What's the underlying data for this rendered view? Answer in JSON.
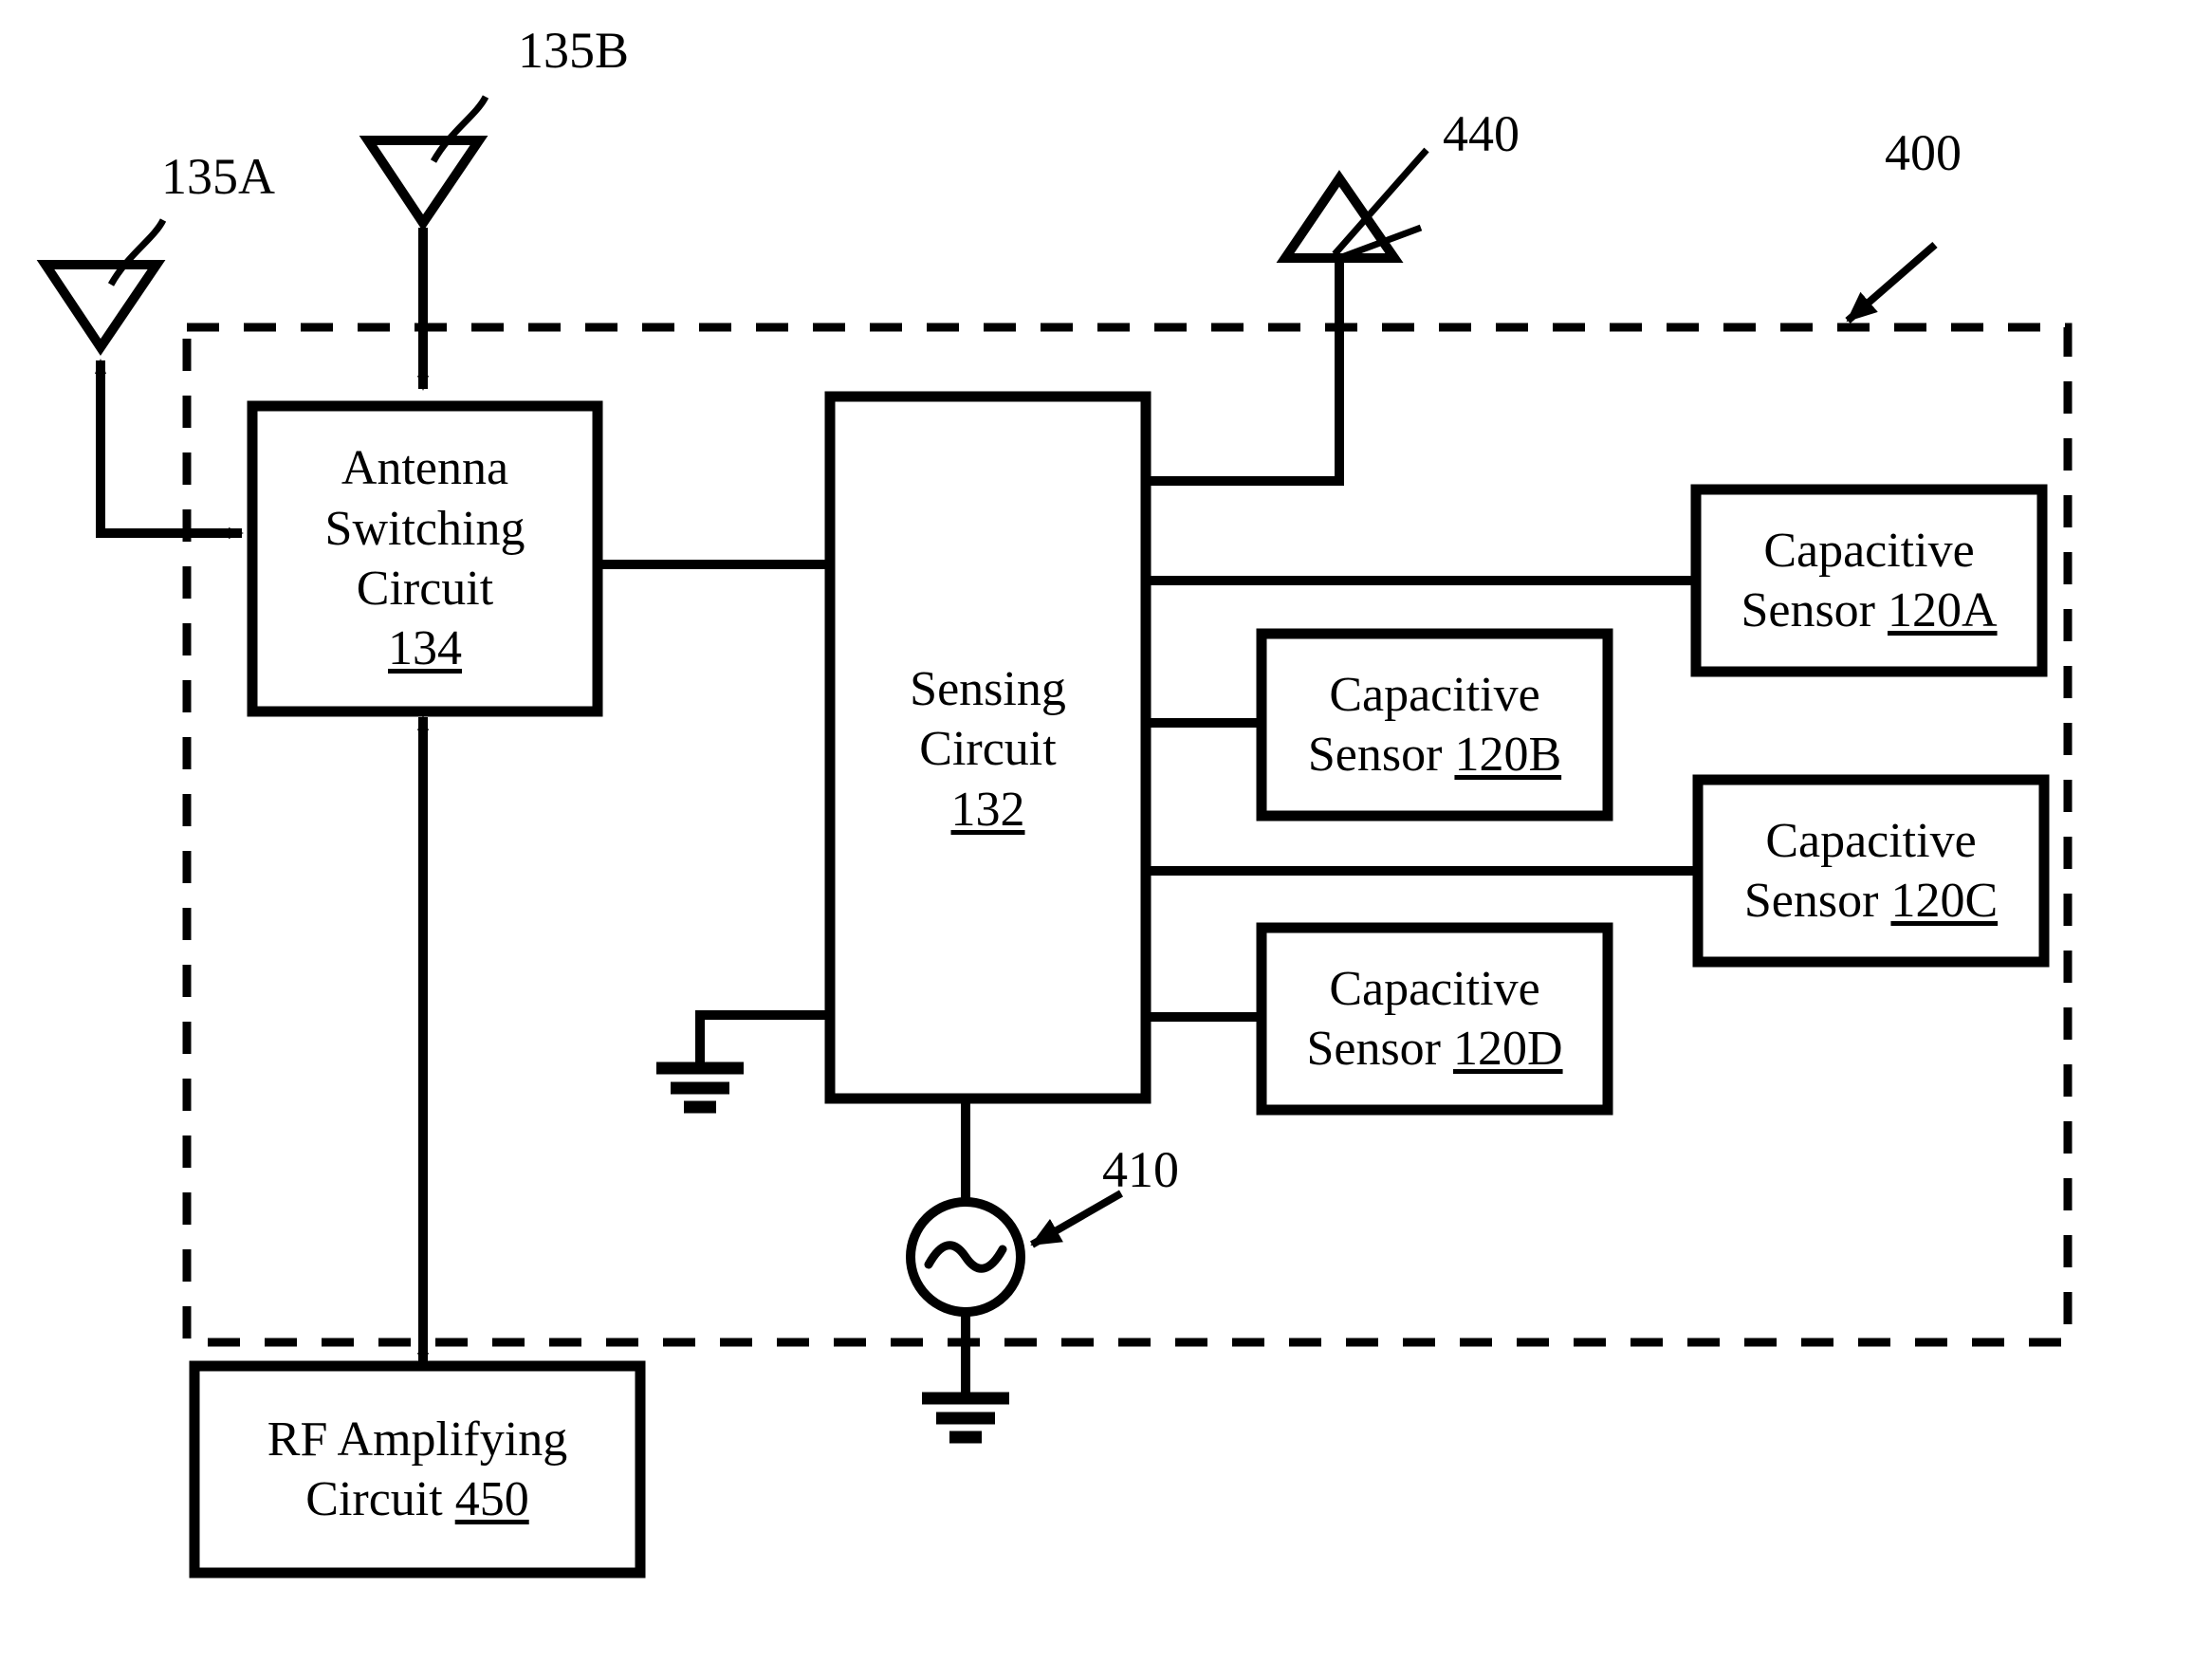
{
  "figure": {
    "type": "patent-block-diagram",
    "reference_labels": [
      {
        "id": "ref-135a",
        "text": "135A"
      },
      {
        "id": "ref-135b",
        "text": "135B"
      },
      {
        "id": "ref-440",
        "text": "440"
      },
      {
        "id": "ref-400",
        "text": "400"
      },
      {
        "id": "ref-410",
        "text": "410"
      }
    ],
    "blocks": [
      {
        "id": "antenna-switching-circuit",
        "lines": [
          "Antenna",
          "Switching",
          "Circuit"
        ],
        "number": "134",
        "number_inline": false
      },
      {
        "id": "sensing-circuit",
        "lines": [
          "Sensing",
          "Circuit"
        ],
        "number": "132",
        "number_inline": false
      },
      {
        "id": "capacitive-sensor-120a",
        "lines": [
          "Capacitive",
          "Sensor"
        ],
        "number": "120A",
        "number_inline": true
      },
      {
        "id": "capacitive-sensor-120b",
        "lines": [
          "Capacitive",
          "Sensor"
        ],
        "number": "120B",
        "number_inline": true
      },
      {
        "id": "capacitive-sensor-120c",
        "lines": [
          "Capacitive",
          "Sensor"
        ],
        "number": "120C",
        "number_inline": true
      },
      {
        "id": "capacitive-sensor-120d",
        "lines": [
          "Capacitive",
          "Sensor"
        ],
        "number": "120D",
        "number_inline": true
      },
      {
        "id": "rf-amplifying-circuit",
        "lines": [
          "RF Amplifying",
          "Circuit"
        ],
        "number": "450",
        "number_inline": true
      }
    ],
    "symbols": [
      {
        "id": "antenna-135a",
        "kind": "antenna-triangle-down"
      },
      {
        "id": "antenna-135b",
        "kind": "antenna-triangle-down"
      },
      {
        "id": "antenna-440",
        "kind": "antenna-triangle-up"
      },
      {
        "id": "oscillator-410",
        "kind": "ac-source-circle-sine"
      },
      {
        "id": "ground-sensing-left",
        "kind": "ground"
      },
      {
        "id": "ground-oscillator",
        "kind": "ground"
      },
      {
        "id": "device-boundary",
        "kind": "dashed-rectangle"
      }
    ],
    "text": {
      "antenna_switching": {
        "l1": "Antenna",
        "l2": "Switching",
        "l3": "Circuit",
        "num": "134"
      },
      "sensing": {
        "l1": "Sensing",
        "l2": "Circuit",
        "num": "132"
      },
      "sensor_a": {
        "l1": "Capacitive",
        "l2": "Sensor",
        "num": "120A"
      },
      "sensor_b": {
        "l1": "Capacitive",
        "l2": "Sensor",
        "num": "120B"
      },
      "sensor_c": {
        "l1": "Capacitive",
        "l2": "Sensor",
        "num": "120C"
      },
      "sensor_d": {
        "l1": "Capacitive",
        "l2": "Sensor",
        "num": "120D"
      },
      "rf_amp": {
        "l1": "RF Amplifying",
        "l2": "Circuit",
        "num": "450"
      },
      "ref_135a": "135A",
      "ref_135b": "135B",
      "ref_440": "440",
      "ref_400": "400",
      "ref_410": "410"
    },
    "colors": {
      "ink": "#000000",
      "paper": "#ffffff"
    }
  }
}
